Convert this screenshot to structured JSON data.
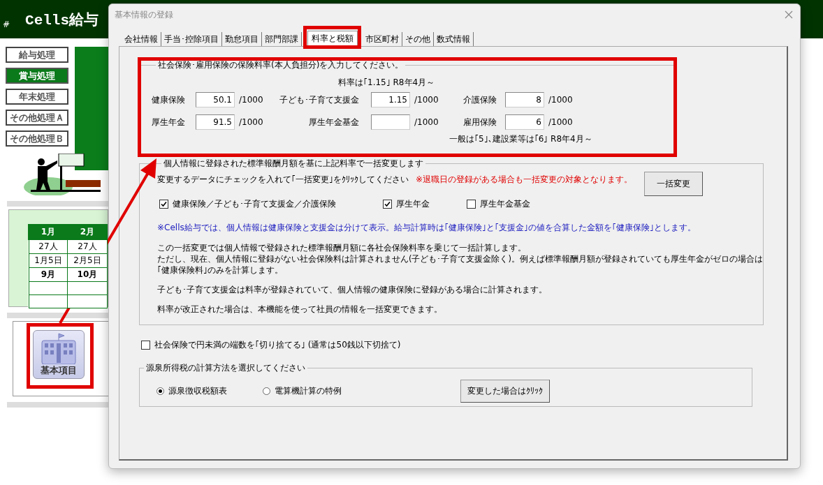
{
  "app": {
    "hash": "#",
    "title": "Cells給与",
    "menu": [
      {
        "label": "給与処理",
        "selected": false
      },
      {
        "label": "賞与処理",
        "selected": true
      },
      {
        "label": "年末処理",
        "selected": false
      },
      {
        "label": "その他処理Ａ",
        "selected": false
      },
      {
        "label": "その他処理Ｂ",
        "selected": false
      }
    ],
    "calendar": {
      "columns": [
        "1月",
        "2月"
      ],
      "rows": [
        {
          "cells": [
            "27人",
            "27人"
          ],
          "bold": false
        },
        {
          "cells": [
            "1月5日",
            "2月5日"
          ],
          "bold": false
        },
        {
          "cells": [
            "9月",
            "10月"
          ],
          "bold": true
        }
      ]
    },
    "icon_button": {
      "label": "基本項目"
    }
  },
  "dialog": {
    "title": "基本情報の登録",
    "tabs": [
      {
        "label": "会社情報",
        "selected": false
      },
      {
        "label": "手当･控除項目",
        "selected": false
      },
      {
        "label": "勤怠項目",
        "selected": false
      },
      {
        "label": "部門部課",
        "selected": false
      },
      {
        "label": "料率と税額",
        "selected": true
      },
      {
        "label": "市区町村",
        "selected": false
      },
      {
        "label": "その他",
        "selected": false
      },
      {
        "label": "数式情報",
        "selected": false
      }
    ],
    "rates": {
      "legend": "社会保険･雇用保険の保険料率(本人負担分)を入力してください。",
      "note": "料率は｢1.15｣ R8年4月～",
      "fields": [
        {
          "label": "健康保険",
          "value": "50.1",
          "unit": "/1000"
        },
        {
          "label": "子ども･子育て支援金",
          "value": "1.15",
          "unit": "/1000"
        },
        {
          "label": "介護保険",
          "value": "8",
          "unit": "/1000"
        },
        {
          "label": "厚生年金",
          "value": "91.5",
          "unit": "/1000"
        },
        {
          "label": "厚生年金基金",
          "unit": "/1000"
        },
        {
          "label": "雇用保険",
          "value": "6",
          "unit": "/1000"
        }
      ],
      "employment_note": "一般は｢5｣､建設業等は｢6｣ R8年4月～"
    },
    "bulk": {
      "legend": "個人情報に登録された標準報酬月額を基に上記料率で一括変更します",
      "instruction": "変更するデータにチェックを入れて｢一括変更｣をｸﾘｯｸしてください",
      "warning": "※退職日の登録がある場合も一括変更の対象となります。",
      "button": "一括変更",
      "checks": [
        {
          "label": "健康保険／子ども･子育て支援金／介護保険",
          "checked": true
        },
        {
          "label": "厚生年金",
          "checked": true
        },
        {
          "label": "厚生年金基金",
          "checked": false
        }
      ],
      "info": "※Cells給与では、個人情報は健康保険と支援金は分けて表示。給与計算時は｢健康保険｣と｢支援金｣の値を合算した金額を｢健康保険｣とします。",
      "paragraphs": [
        {
          "lines": [
            "この一括変更では個人情報で登録された標準報酬月額に各社会保険料率を乗じて一括計算します。",
            "ただし、現在、個人情報に登録がない社会保険料は計算されません(子ども･子育て支援金除く)。例えば標準報酬月額が登録されていても厚生年金がゼロの場合は",
            "｢健康保険料｣のみを計算します。"
          ]
        },
        {
          "lines": [
            "子ども･子育て支援金は料率が登録されていて、個人情報の健康保険に登録がある場合に計算されます。"
          ]
        },
        {
          "lines": [
            "料率が改正された場合は、本機能を使って社員の情報を一括変更できます。"
          ]
        }
      ]
    },
    "rounding": {
      "label": "社会保険で円未満の端数を｢切り捨てる｣ (通常は50銭以下切捨て)",
      "checked": false
    },
    "withholding": {
      "legend": "源泉所得税の計算方法を選択してください",
      "options": [
        {
          "label": "源泉徴収税額表",
          "selected": true
        },
        {
          "label": "電算機計算の特例",
          "selected": false
        }
      ],
      "button": "変更した場合はｸﾘｯｸ"
    }
  }
}
